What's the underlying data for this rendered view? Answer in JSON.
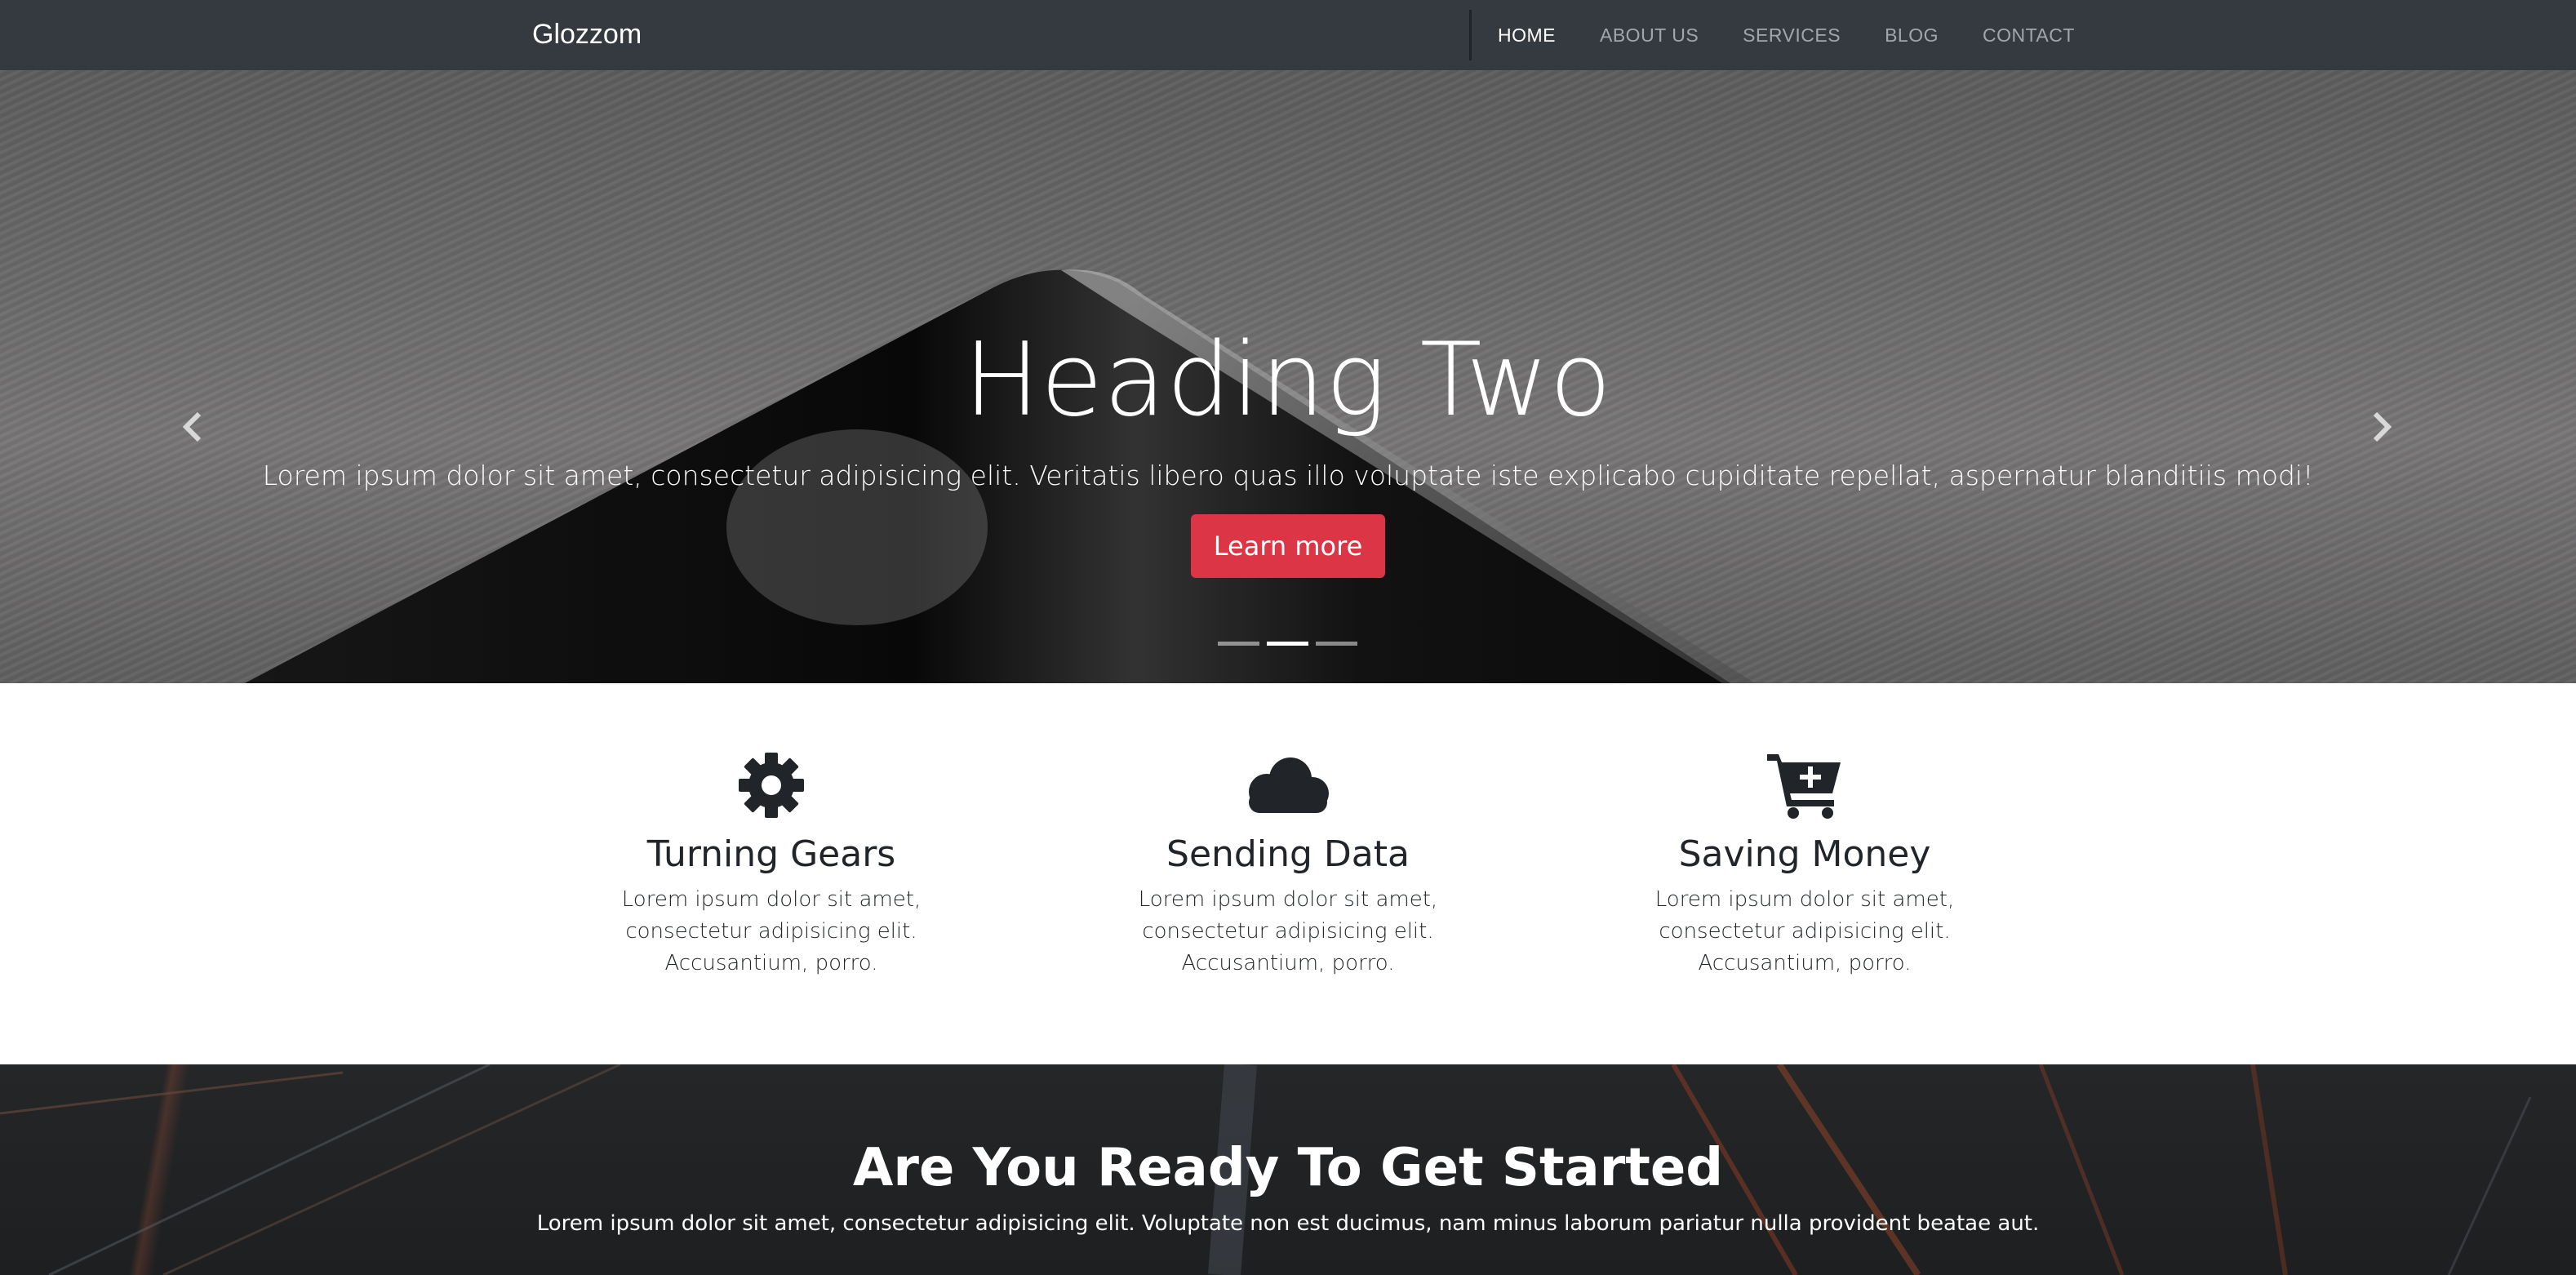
{
  "navbar": {
    "brand": "Glozzom",
    "links": [
      {
        "label": "HOME",
        "active": true
      },
      {
        "label": "ABOUT US",
        "active": false
      },
      {
        "label": "SERVICES",
        "active": false
      },
      {
        "label": "BLOG",
        "active": false
      },
      {
        "label": "CONTACT",
        "active": false
      }
    ]
  },
  "hero": {
    "title": "Heading Two",
    "text": "Lorem ipsum dolor sit amet, consectetur adipisicing elit. Veritatis libero quas illo voluptate iste explicabo cupiditate repellat, aspernatur blanditiis modi!",
    "button_label": "Learn more",
    "button_color": "#dc3545",
    "slide_count": 3,
    "active_slide": 2,
    "prev_icon": "chevron-left-icon",
    "next_icon": "chevron-right-icon"
  },
  "features": [
    {
      "icon": "gear-icon",
      "title": "Turning Gears",
      "text": "Lorem ipsum dolor sit amet, consectetur adipisicing elit. Accusantium, porro."
    },
    {
      "icon": "cloud-icon",
      "title": "Sending Data",
      "text": "Lorem ipsum dolor sit amet, consectetur adipisicing elit. Accusantium, porro."
    },
    {
      "icon": "cart-plus-icon",
      "title": "Saving Money",
      "text": "Lorem ipsum dolor sit amet, consectetur adipisicing elit. Accusantium, porro."
    }
  ],
  "cta": {
    "title": "Are You Ready To Get Started",
    "text": "Lorem ipsum dolor sit amet, consectetur adipisicing elit. Voluptate non est ducimus, nam minus laborum pariatur nulla provident beatae aut."
  },
  "colors": {
    "navbar_bg": "#343a40",
    "accent": "#dc3545",
    "text_dark": "#212529"
  }
}
